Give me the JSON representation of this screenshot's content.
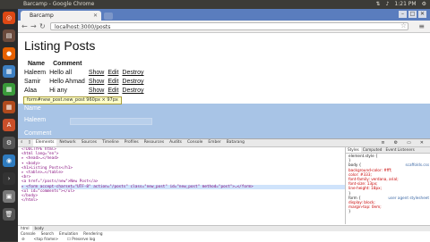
{
  "system": {
    "window_title": "Barcamp - Google Chrome",
    "clock": "1:21 PM"
  },
  "browser": {
    "tab_title": "Barcamp",
    "url": "localhost:3000/posts"
  },
  "page": {
    "heading": "Listing Posts",
    "columns": [
      "Name",
      "Comment"
    ],
    "rows": [
      {
        "name": "Haleem",
        "comment": "Hello all",
        "show": "Show",
        "edit": "Edit",
        "destroy": "Destroy"
      },
      {
        "name": "Samir",
        "comment": "Hello Ahmad",
        "show": "Show",
        "edit": "Edit",
        "destroy": "Destroy"
      },
      {
        "name": "Alaa",
        "comment": "Hi any",
        "show": "Show",
        "edit": "Edit",
        "destroy": "Destroy"
      }
    ],
    "tooltip": "form#new_post.new_post 960px × 97px",
    "form_labels": [
      "Name",
      "Haleem",
      "Comment"
    ]
  },
  "devtools": {
    "tabs": [
      "Elements",
      "Network",
      "Sources",
      "Timeline",
      "Profiles",
      "Resources",
      "Audits",
      "Console",
      "Ember",
      "Batarang"
    ],
    "active_tab": "Elements",
    "dom_lines": [
      "<!DOCTYPE html>",
      "<html lang=\"en\">",
      "▸ <head>…</head>",
      "▾ <body>",
      "    <h1>Listing Posts</h1>",
      "  ▸ <table>…</table>",
      "    <br>",
      "    <a href=\"/posts/new\">New Post</a>",
      "  ▸ <form accept-charset=\"UTF-8\" action=\"/posts\" class=\"new_post\" id=\"new_post\" method=\"post\">…</form>",
      "    <ul id=\"comments\"></ul>",
      "  </body>",
      "</html>"
    ],
    "styles_tabs": [
      "Styles",
      "Computed",
      "Event Listeners"
    ],
    "styles_lines": [
      {
        "text": "element.style {",
        "src": ""
      },
      {
        "text": "}",
        "src": ""
      },
      {
        "text": "body {",
        "src": "scaffolds.css"
      },
      {
        "text": "  background-color: #fff;",
        "src": ""
      },
      {
        "text": "  color: #333;",
        "src": ""
      },
      {
        "text": "  font-family: verdana, arial;",
        "src": ""
      },
      {
        "text": "  font-size: 13px;",
        "src": ""
      },
      {
        "text": "  line-height: 18px;",
        "src": ""
      },
      {
        "text": "}",
        "src": ""
      },
      {
        "text": "form {",
        "src": "user agent stylesheet"
      },
      {
        "text": "  display: block;",
        "src": ""
      },
      {
        "text": "  margin-top: 0em;",
        "src": ""
      },
      {
        "text": "}",
        "src": ""
      }
    ],
    "console_tabs": [
      "html",
      "body"
    ],
    "drawer_tabs": [
      "Console",
      "Search",
      "Emulation",
      "Rendering"
    ],
    "drawer_options": [
      "<top frame>",
      "Preserve log"
    ]
  }
}
